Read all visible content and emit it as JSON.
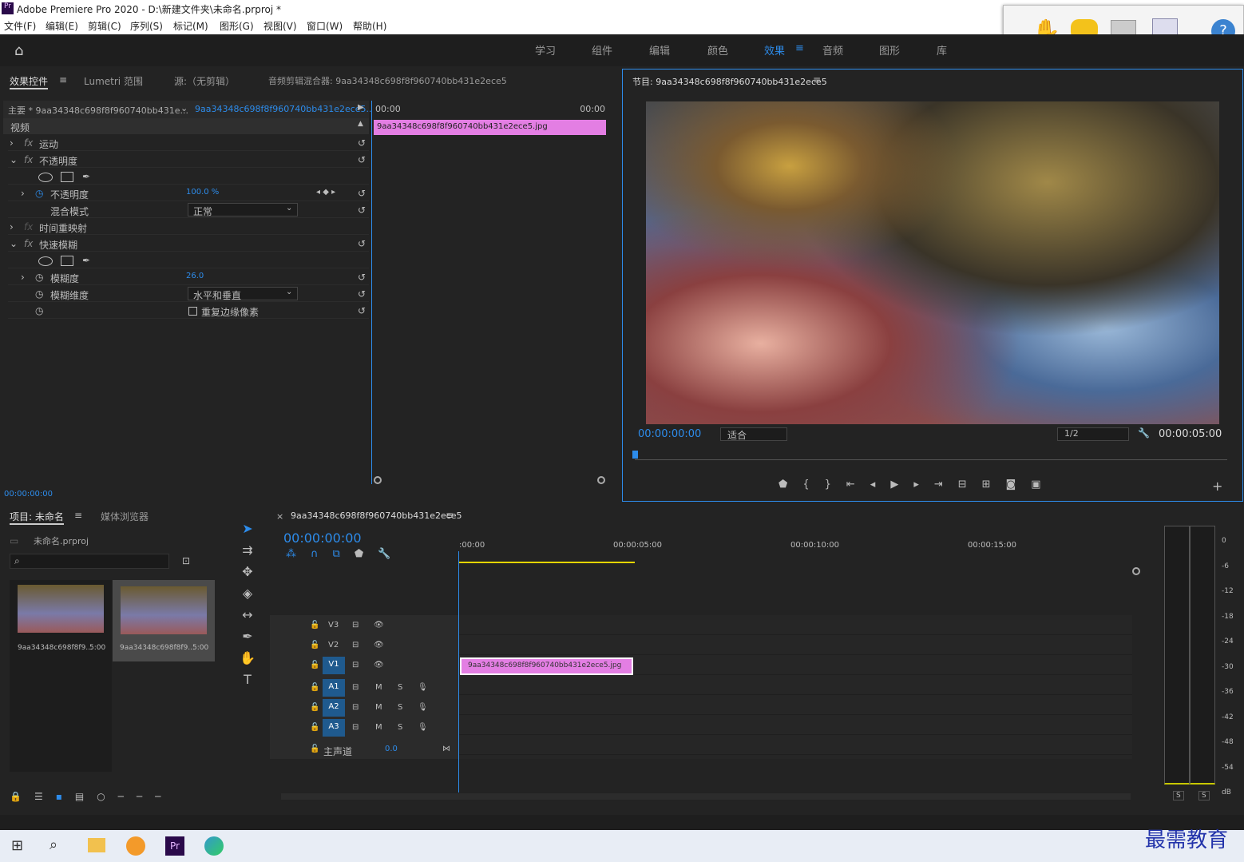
{
  "window": {
    "title": "Adobe Premiere Pro 2020 - D:\\新建文件夹\\未命名.prproj *"
  },
  "menu": [
    "文件(F)",
    "编辑(E)",
    "剪辑(C)",
    "序列(S)",
    "标记(M)",
    "图形(G)",
    "视图(V)",
    "窗口(W)",
    "帮助(H)"
  ],
  "workspaces": [
    "学习",
    "组件",
    "编辑",
    "颜色",
    "效果",
    "音频",
    "图形",
    "库"
  ],
  "active_workspace": "效果",
  "effects_panel": {
    "tabs": [
      "效果控件",
      "Lumetri 范围",
      "源:（无剪辑）",
      "音频剪辑混合器: 9aa34348c698f8f960740bb431e2ece5"
    ],
    "master_label": "主要 * 9aa34348c698f8f960740bb431e...",
    "clip_label": "9aa34348c698f8f960740bb431e2ece5...",
    "tc_start": "00:00",
    "tc_end": "00:00",
    "clip_bar": "9aa34348c698f8f960740bb431e2ece5.jpg",
    "section": "视频",
    "rows": [
      {
        "label": "运动",
        "fx": true
      },
      {
        "label": "不透明度",
        "fx": true
      },
      {
        "label": "不透明度",
        "value": "100.0 %"
      },
      {
        "label": "混合模式",
        "dropdown": "正常"
      },
      {
        "label": "时间重映射",
        "fx": true
      },
      {
        "label": "快速模糊",
        "fx": true
      },
      {
        "label": "模糊度",
        "value": "26.0"
      },
      {
        "label": "模糊维度",
        "dropdown": "水平和垂直"
      },
      {
        "label": "",
        "checkbox": "重复边缘像素"
      }
    ],
    "timecode": "00:00:00:00"
  },
  "program": {
    "title": "节目: 9aa34348c698f8f960740bb431e2ece5",
    "timecode": "00:00:00:00",
    "fit": "适合",
    "res": "1/2",
    "duration": "00:00:05:00"
  },
  "project": {
    "tabs": [
      "项目: 未命名",
      "媒体浏览器"
    ],
    "file": "未命名.prproj",
    "items": [
      {
        "name": "9aa34348c698f8f9...",
        "dur": "5:00"
      },
      {
        "name": "9aa34348c698f8f9...",
        "dur": "5:00"
      }
    ]
  },
  "timeline": {
    "tab": "9aa34348c698f8f960740bb431e2ece5",
    "timecode": "00:00:00:00",
    "ruler": [
      ":00:00",
      "00:00:05:00",
      "00:00:10:00",
      "00:00:15:00"
    ],
    "video_tracks": [
      "V3",
      "V2",
      "V1"
    ],
    "audio_tracks": [
      "A1",
      "A2",
      "A3"
    ],
    "master": "主声道",
    "master_val": "0.0",
    "clip": "9aa34348c698f8f960740bb431e2ece5.jpg"
  },
  "meter": {
    "scale": [
      "0",
      "-6",
      "-12",
      "-18",
      "-24",
      "-30",
      "-36",
      "-42",
      "-48",
      "-54",
      "dB"
    ],
    "solo": [
      "S",
      "S"
    ]
  },
  "watermark": "最需教育"
}
